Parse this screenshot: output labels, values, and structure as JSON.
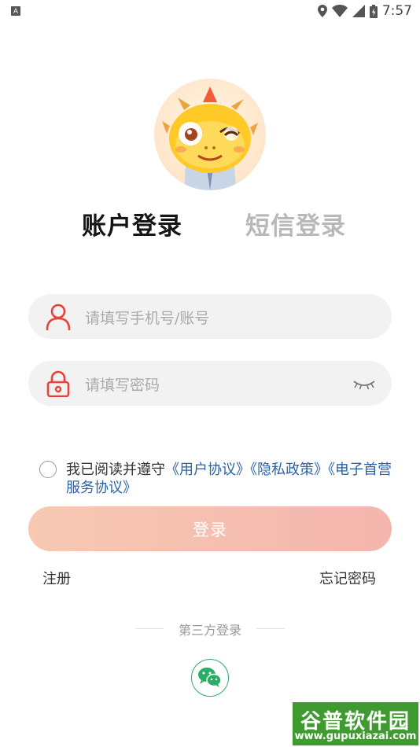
{
  "status_bar": {
    "left_badge": "A",
    "time": "7:57"
  },
  "tabs": {
    "account_login": "账户登录",
    "sms_login": "短信登录"
  },
  "form": {
    "phone_placeholder": "请填写手机号/账号",
    "password_placeholder": "请填写密码"
  },
  "agreement": {
    "prefix": "我已阅读并遵守",
    "user_agreement": "《用户协议》",
    "privacy_policy": "《隐私政策》",
    "service_agreement": "《电子首营服务协议》"
  },
  "buttons": {
    "login": "登录",
    "register": "注册",
    "forgot_password": "忘记密码"
  },
  "third_party": {
    "label": "第三方登录",
    "providers": [
      "wechat-icon"
    ]
  },
  "watermark": {
    "title": "谷普软件园",
    "url": "www.gupuxiazai.com"
  },
  "colors": {
    "accent_red": "#e8423a",
    "link_blue": "#2b62a4",
    "login_gradient_start": "#f6c9b2",
    "login_gradient_end": "#f5b5ae",
    "wechat_green": "#2aae67"
  }
}
